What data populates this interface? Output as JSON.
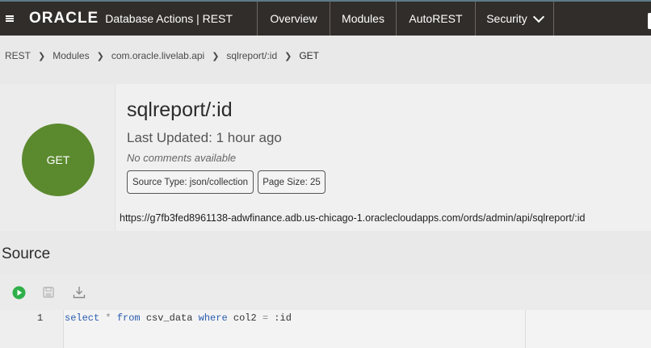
{
  "header": {
    "logo": "ORACLE",
    "app_title": "Database Actions | REST",
    "tabs": [
      {
        "label": "Overview"
      },
      {
        "label": "Modules"
      },
      {
        "label": "AutoREST"
      },
      {
        "label": "Security"
      }
    ],
    "colors": {
      "bar": "#312d2a",
      "accent_line": "#5d7b8a"
    }
  },
  "breadcrumb": [
    "REST",
    "Modules",
    "com.oracle.livelab.api",
    "sqlreport/:id",
    "GET"
  ],
  "handler": {
    "method": "GET",
    "method_color": "#5b8a2e",
    "title": "sqlreport/:id",
    "last_updated": "Last Updated: 1 hour ago",
    "comments": "No comments available",
    "source_type": "Source Type: json/collection",
    "page_size": "Page Size: 25",
    "url": "https://g7fb3fed8961138-adwfinance.adb.us-chicago-1.oraclecloudapps.com/ords/admin/api/sqlreport/:id"
  },
  "source": {
    "heading": "Source",
    "toolbar_icons": [
      "run-icon",
      "save-icon",
      "download-icon"
    ],
    "line_number": "1",
    "code_tokens": [
      {
        "t": "select",
        "c": "kw"
      },
      {
        "t": " ",
        "c": ""
      },
      {
        "t": "*",
        "c": "op"
      },
      {
        "t": " ",
        "c": ""
      },
      {
        "t": "from",
        "c": "kw"
      },
      {
        "t": " csv_data ",
        "c": ""
      },
      {
        "t": "where",
        "c": "kw"
      },
      {
        "t": " col2 ",
        "c": ""
      },
      {
        "t": "=",
        "c": "op"
      },
      {
        "t": " :id",
        "c": ""
      }
    ]
  }
}
